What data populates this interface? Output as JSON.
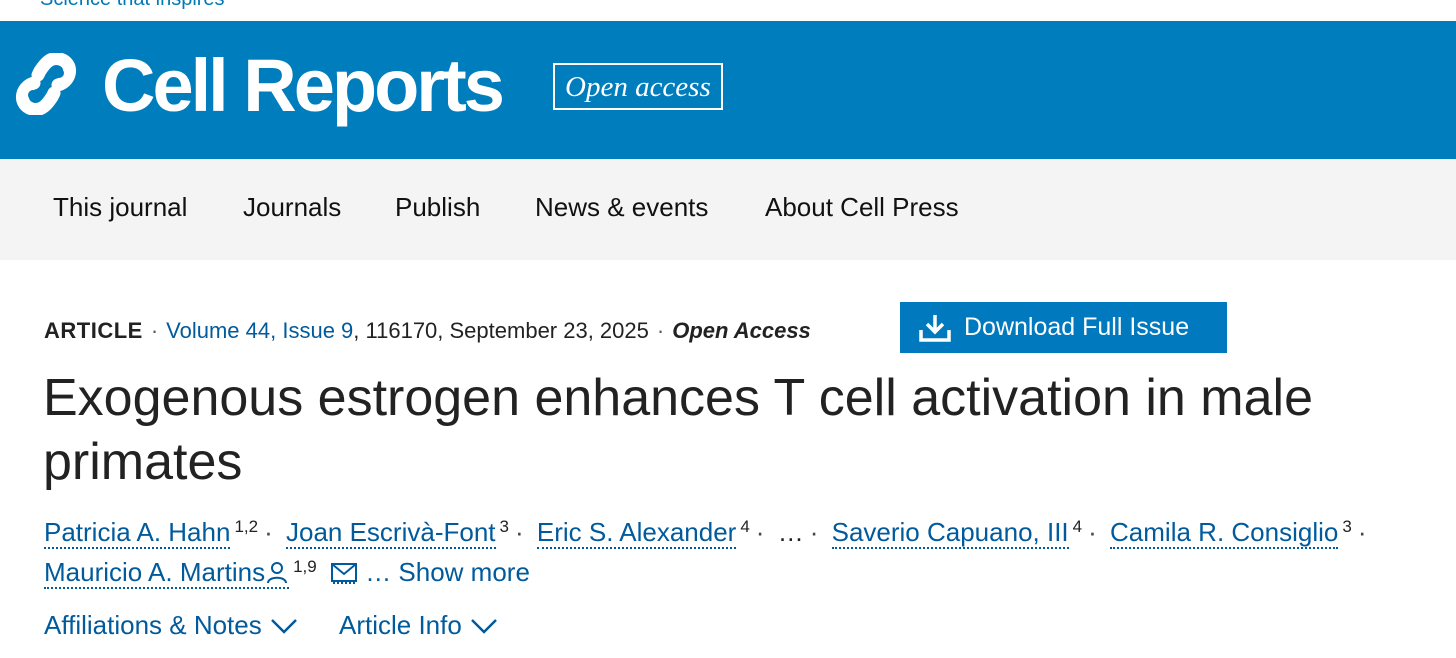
{
  "top": {
    "tagline": "Science that inspires"
  },
  "brand": {
    "name": "Cell Reports",
    "badge": "Open access",
    "bar_color": "#007dbc"
  },
  "nav": {
    "items": [
      "This journal",
      "Journals",
      "Publish",
      "News & events",
      "About Cell Press"
    ]
  },
  "article": {
    "type": "ARTICLE",
    "volume_issue": "Volume 44, Issue 9",
    "article_number_date": ", 116170, September 23, 2025",
    "access": "Open Access",
    "download_label": "Download Full Issue",
    "title": "Exogenous estrogen enhances T cell activation in male primates",
    "authors": [
      {
        "name": "Patricia A. Hahn",
        "aff": "1,2"
      },
      {
        "name": "Joan Escrivà-Font",
        "aff": "3"
      },
      {
        "name": "Eric S. Alexander",
        "aff": "4"
      },
      {
        "name": "Saverio Capuano, III",
        "aff": "4"
      },
      {
        "name": "Camila R. Consiglio",
        "aff": "3"
      },
      {
        "name": "Mauricio A. Martins",
        "aff": "1,9"
      }
    ],
    "ellipsis": "…",
    "show_more": "… Show more",
    "affiliations_label": "Affiliations & Notes",
    "article_info_label": "Article Info"
  },
  "icons": {
    "logo": "cell-press-logo-icon",
    "download": "download-icon",
    "person": "person-icon",
    "email": "envelope-icon",
    "chevron": "chevron-down-icon"
  }
}
